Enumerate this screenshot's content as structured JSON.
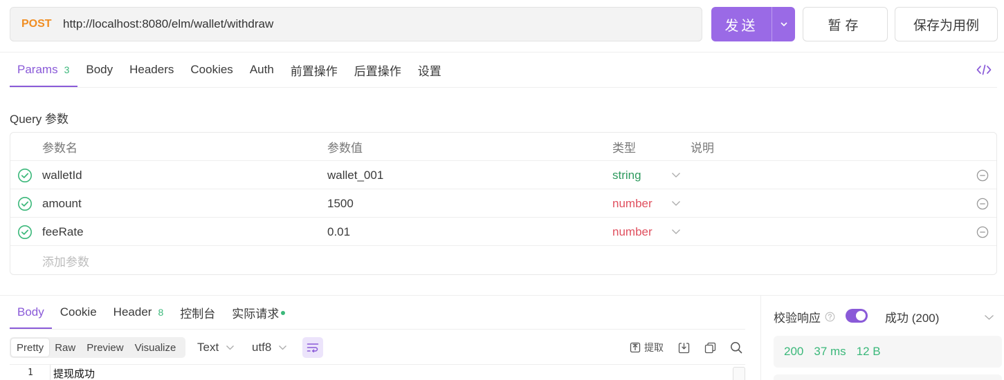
{
  "request": {
    "method": "POST",
    "url": "http://localhost:8080/elm/wallet/withdraw",
    "send_label": "发送",
    "save_label": "暂存",
    "save_case_label": "保存为用例"
  },
  "request_tabs": [
    {
      "label": "Params",
      "count": "3"
    },
    {
      "label": "Body"
    },
    {
      "label": "Headers"
    },
    {
      "label": "Cookies"
    },
    {
      "label": "Auth"
    },
    {
      "label": "前置操作"
    },
    {
      "label": "后置操作"
    },
    {
      "label": "设置"
    }
  ],
  "query": {
    "section_label": "Query 参数",
    "headers": {
      "name": "参数名",
      "value": "参数值",
      "type": "类型",
      "desc": "说明"
    },
    "params": [
      {
        "name": "walletId",
        "value": "wallet_001",
        "type": "string"
      },
      {
        "name": "amount",
        "value": "1500",
        "type": "number"
      },
      {
        "name": "feeRate",
        "value": "0.01",
        "type": "number"
      }
    ],
    "add_placeholder": "添加参数"
  },
  "response_tabs": [
    {
      "label": "Body"
    },
    {
      "label": "Cookie"
    },
    {
      "label": "Header",
      "count": "8"
    },
    {
      "label": "控制台"
    },
    {
      "label": "实际请求"
    }
  ],
  "response_toolbar": {
    "formats": [
      "Pretty",
      "Raw",
      "Preview",
      "Visualize"
    ],
    "format_selected": "Pretty",
    "content_type": "Text",
    "encoding": "utf8",
    "extract_label": "提取"
  },
  "response_body": {
    "lines": [
      {
        "no": "1",
        "text": "提现成功"
      }
    ]
  },
  "validation": {
    "label": "校验响应",
    "status_text": "成功 (200)",
    "stats": {
      "status": "200",
      "time": "37 ms",
      "size": "12 B"
    }
  },
  "colors": {
    "accent": "#8a5ad8",
    "method_post": "#f08d22",
    "success_green": "#3bb87a",
    "type_string": "#2e9a5e",
    "type_number": "#e0505f"
  }
}
